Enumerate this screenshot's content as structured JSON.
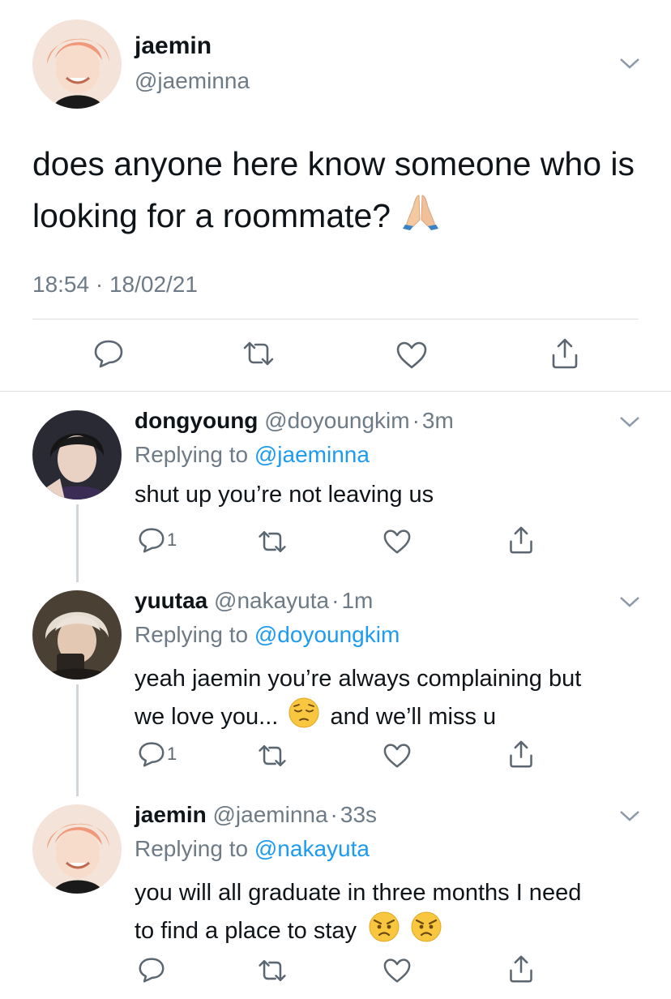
{
  "main_tweet": {
    "display_name": "jaemin",
    "handle": "@jaeminna",
    "text": "does anyone here know someone who is looking for a roommate?",
    "emoji": "praying-hands",
    "timestamp": "18:54 · 18/02/21"
  },
  "replies": [
    {
      "display_name": "dongyoung",
      "handle": "@doyoungkim",
      "separator": "·",
      "time": "3m",
      "replying_label": "Replying to",
      "replying_to": "@jaeminna",
      "text": "shut up you’re not leaving us",
      "reply_count": "1"
    },
    {
      "display_name": "yuutaa",
      "handle": "@nakayuta",
      "separator": "·",
      "time": "1m",
      "replying_label": "Replying to",
      "replying_to": "@doyoungkim",
      "text_line1": "yeah jaemin you’re always complaining but",
      "text_line2a": "we love you...",
      "text_line2b": "and we’ll miss u",
      "reply_count": "1"
    },
    {
      "display_name": "jaemin",
      "handle": "@jaeminna",
      "separator": "·",
      "time": "33s",
      "replying_label": "Replying to",
      "replying_to": "@nakayuta",
      "text_line1": "you will all graduate in three months I need",
      "text_line2": "to find a place to stay"
    }
  ],
  "colors": {
    "text": "#0f1419",
    "muted": "#6e7b86",
    "link": "#1d9bf0",
    "divider": "#d9dfe4",
    "icon": "#5b6670"
  }
}
